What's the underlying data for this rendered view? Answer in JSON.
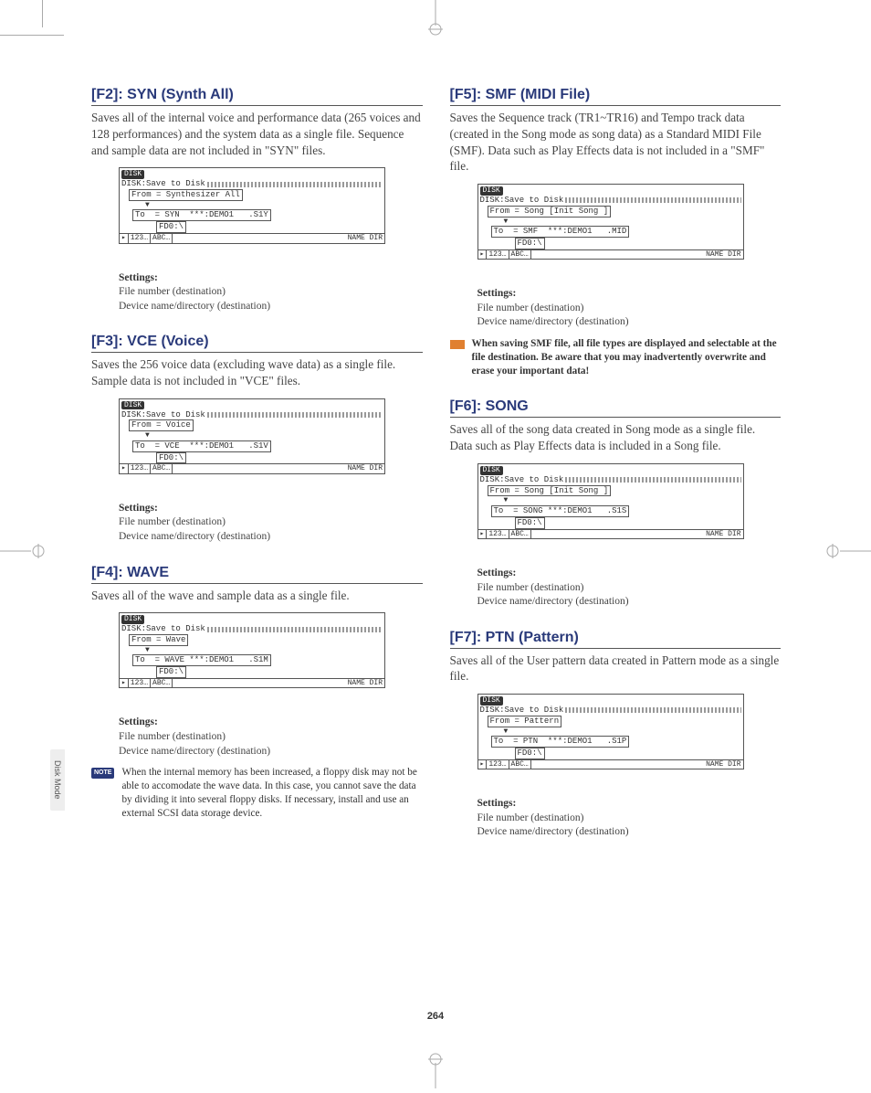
{
  "page_number": "264",
  "side_tab": "Disk Mode",
  "lcd_common": {
    "top_tab": "DISK",
    "title": "DISK:Save to Disk",
    "footer_left1": "▸",
    "footer_left2": "123…",
    "footer_left3": "ABC…",
    "footer_right": "NAME DIR",
    "fd_label": "FD0:\\"
  },
  "left": {
    "f2": {
      "heading": "[F2]: SYN (Synth All)",
      "body": "Saves all of the internal voice and performance data (265 voices and 128 performances) and the system data as a single file. Sequence and sample data are not included in \"SYN\" files.",
      "from": "From = Synthesizer All",
      "to": "To  = SYN  ***:DEMO1   .S1Y",
      "settings_label": "Settings:",
      "settings1": "File number (destination)",
      "settings2": "Device name/directory (destination)"
    },
    "f3": {
      "heading": "[F3]: VCE (Voice)",
      "body": "Saves the 256 voice data (excluding wave data) as a single file. Sample data is not included in \"VCE\" files.",
      "from": "From = Voice",
      "to": "To  = VCE  ***:DEMO1   .S1V",
      "settings_label": "Settings:",
      "settings1": "File number (destination)",
      "settings2": "Device name/directory (destination)"
    },
    "f4": {
      "heading": "[F4]: WAVE",
      "body": "Saves all of the wave and sample data as a single file.",
      "from": "From = Wave",
      "to": "To  = WAVE ***:DEMO1   .S1M",
      "settings_label": "Settings:",
      "settings1": "File number (destination)",
      "settings2": "Device name/directory (destination)",
      "note_badge": "NOTE",
      "note": "When the internal memory has been increased, a floppy disk may not be able to accomodate the wave data. In this case, you cannot save the data by dividing it into several floppy disks. If necessary, install and use an external SCSI data storage device."
    }
  },
  "right": {
    "f5": {
      "heading": "[F5]: SMF (MIDI File)",
      "body": "Saves the Sequence track (TR1~TR16) and Tempo track data (created in the Song mode as song data) as a Standard MIDI File (SMF). Data such as Play Effects data is not included in a \"SMF\" file.",
      "from": "From = Song [Init Song ]",
      "to": "To  = SMF  ***:DEMO1   .MID",
      "settings_label": "Settings:",
      "settings1": "File number (destination)",
      "settings2": "Device name/directory (destination)",
      "warn": "When saving SMF file, all file types are displayed and selectable at the file destination. Be aware that you may inadvertently overwrite and erase your important data!"
    },
    "f6": {
      "heading": "[F6]: SONG",
      "body": "Saves all of the song data created in Song mode as a single file. Data such as Play Effects data is included in a Song file.",
      "from": "From = Song [Init Song ]",
      "to": "To  = SONG ***:DEMO1   .S1S",
      "settings_label": "Settings:",
      "settings1": "File number (destination)",
      "settings2": "Device name/directory (destination)"
    },
    "f7": {
      "heading": "[F7]: PTN (Pattern)",
      "body": "Saves all of the User pattern data created in Pattern mode as a single file.",
      "from": "From = Pattern",
      "to": "To  = PTN  ***:DEMO1   .S1P",
      "settings_label": "Settings:",
      "settings1": "File number (destination)",
      "settings2": "Device name/directory (destination)"
    }
  }
}
